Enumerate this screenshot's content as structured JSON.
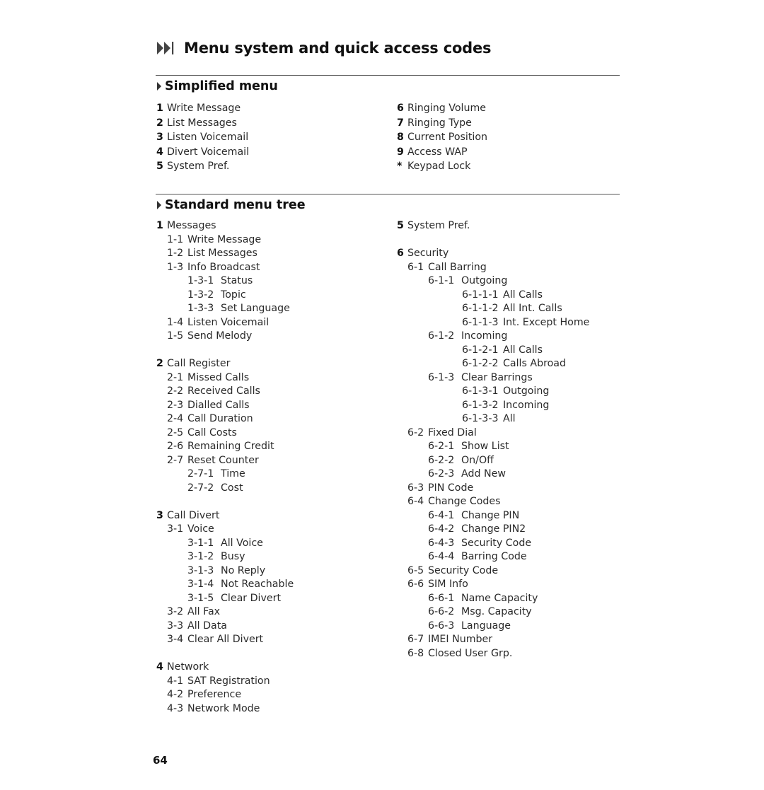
{
  "page_title": "Menu system and quick access codes",
  "title_icon": "skip-forward-icon",
  "simplified": {
    "heading": "Simplified menu",
    "left": [
      {
        "key": "1",
        "label": "Write Message"
      },
      {
        "key": "2",
        "label": "List Messages"
      },
      {
        "key": "3",
        "label": "Listen Voicemail"
      },
      {
        "key": "4",
        "label": "Divert Voicemail"
      },
      {
        "key": "5",
        "label": "System Pref."
      }
    ],
    "right": [
      {
        "key": "6",
        "label": "Ringing Volume"
      },
      {
        "key": "7",
        "label": "Ringing Type"
      },
      {
        "key": "8",
        "label": "Current Position"
      },
      {
        "key": "9",
        "label": "Access WAP"
      },
      {
        "key": "*",
        "label": "Keypad Lock"
      }
    ]
  },
  "standard": {
    "heading": "Standard menu tree",
    "left": [
      {
        "level": 0,
        "code": "1",
        "label": "Messages"
      },
      {
        "level": 1,
        "code": "1-1",
        "label": "Write Message"
      },
      {
        "level": 1,
        "code": "1-2",
        "label": "List Messages"
      },
      {
        "level": 1,
        "code": "1-3",
        "label": "Info Broadcast"
      },
      {
        "level": 2,
        "code": "1-3-1",
        "label": "Status"
      },
      {
        "level": 2,
        "code": "1-3-2",
        "label": "Topic"
      },
      {
        "level": 2,
        "code": "1-3-3",
        "label": "Set Language"
      },
      {
        "level": 1,
        "code": "1-4",
        "label": "Listen Voicemail"
      },
      {
        "level": 1,
        "code": "1-5",
        "label": "Send Melody"
      },
      {
        "gap": true
      },
      {
        "level": 0,
        "code": "2",
        "label": "Call Register"
      },
      {
        "level": 1,
        "code": "2-1",
        "label": "Missed Calls"
      },
      {
        "level": 1,
        "code": "2-2",
        "label": "Received Calls"
      },
      {
        "level": 1,
        "code": "2-3",
        "label": "Dialled Calls"
      },
      {
        "level": 1,
        "code": "2-4",
        "label": "Call Duration"
      },
      {
        "level": 1,
        "code": "2-5",
        "label": "Call Costs"
      },
      {
        "level": 1,
        "code": "2-6",
        "label": "Remaining Credit"
      },
      {
        "level": 1,
        "code": "2-7",
        "label": "Reset Counter"
      },
      {
        "level": 2,
        "code": "2-7-1",
        "label": "Time"
      },
      {
        "level": 2,
        "code": "2-7-2",
        "label": "Cost"
      },
      {
        "gap": true
      },
      {
        "level": 0,
        "code": "3",
        "label": "Call Divert"
      },
      {
        "level": 1,
        "code": "3-1",
        "label": "Voice"
      },
      {
        "level": 2,
        "code": "3-1-1",
        "label": "All Voice"
      },
      {
        "level": 2,
        "code": "3-1-2",
        "label": "Busy"
      },
      {
        "level": 2,
        "code": "3-1-3",
        "label": "No Reply"
      },
      {
        "level": 2,
        "code": "3-1-4",
        "label": "Not Reachable"
      },
      {
        "level": 2,
        "code": "3-1-5",
        "label": "Clear Divert"
      },
      {
        "level": 1,
        "code": "3-2",
        "label": "All Fax"
      },
      {
        "level": 1,
        "code": "3-3",
        "label": "All Data"
      },
      {
        "level": 1,
        "code": "3-4",
        "label": "Clear All Divert"
      },
      {
        "gap": true
      },
      {
        "level": 0,
        "code": "4",
        "label": "Network"
      },
      {
        "level": 1,
        "code": "4-1",
        "label": "SAT Registration"
      },
      {
        "level": 1,
        "code": "4-2",
        "label": "Preference"
      },
      {
        "level": 1,
        "code": "4-3",
        "label": "Network Mode"
      }
    ],
    "right": [
      {
        "level": 0,
        "code": "5",
        "label": "System Pref."
      },
      {
        "gap": true
      },
      {
        "level": 0,
        "code": "6",
        "label": "Security"
      },
      {
        "level": 1,
        "code": "6-1",
        "label": "Call Barring"
      },
      {
        "level": 2,
        "code": "6-1-1",
        "label": "Outgoing"
      },
      {
        "level": 3,
        "code": "6-1-1-1",
        "label": "All Calls"
      },
      {
        "level": 3,
        "code": "6-1-1-2",
        "label": "All Int. Calls"
      },
      {
        "level": 3,
        "code": "6-1-1-3",
        "label": "Int. Except Home"
      },
      {
        "level": 2,
        "code": "6-1-2",
        "label": "Incoming"
      },
      {
        "level": 3,
        "code": "6-1-2-1",
        "label": "All Calls"
      },
      {
        "level": 3,
        "code": "6-1-2-2",
        "label": "Calls Abroad"
      },
      {
        "level": 2,
        "code": "6-1-3",
        "label": "Clear Barrings"
      },
      {
        "level": 3,
        "code": "6-1-3-1",
        "label": "Outgoing"
      },
      {
        "level": 3,
        "code": "6-1-3-2",
        "label": "Incoming"
      },
      {
        "level": 3,
        "code": "6-1-3-3",
        "label": "All"
      },
      {
        "level": 1,
        "code": "6-2",
        "label": "Fixed Dial"
      },
      {
        "level": 2,
        "code": "6-2-1",
        "label": "Show List"
      },
      {
        "level": 2,
        "code": "6-2-2",
        "label": "On/Off"
      },
      {
        "level": 2,
        "code": "6-2-3",
        "label": "Add New"
      },
      {
        "level": 1,
        "code": "6-3",
        "label": "PIN Code"
      },
      {
        "level": 1,
        "code": "6-4",
        "label": "Change Codes"
      },
      {
        "level": 2,
        "code": "6-4-1",
        "label": "Change PIN"
      },
      {
        "level": 2,
        "code": "6-4-2",
        "label": "Change PIN2"
      },
      {
        "level": 2,
        "code": "6-4-3",
        "label": "Security Code"
      },
      {
        "level": 2,
        "code": "6-4-4",
        "label": "Barring Code"
      },
      {
        "level": 1,
        "code": "6-5",
        "label": "Security Code"
      },
      {
        "level": 1,
        "code": "6-6",
        "label": "SIM Info"
      },
      {
        "level": 2,
        "code": "6-6-1",
        "label": "Name Capacity"
      },
      {
        "level": 2,
        "code": "6-6-2",
        "label": "Msg. Capacity"
      },
      {
        "level": 2,
        "code": "6-6-3",
        "label": "Language"
      },
      {
        "level": 1,
        "code": "6-7",
        "label": "IMEI Number"
      },
      {
        "level": 1,
        "code": "6-8",
        "label": "Closed User Grp."
      }
    ]
  },
  "page_number": "64"
}
